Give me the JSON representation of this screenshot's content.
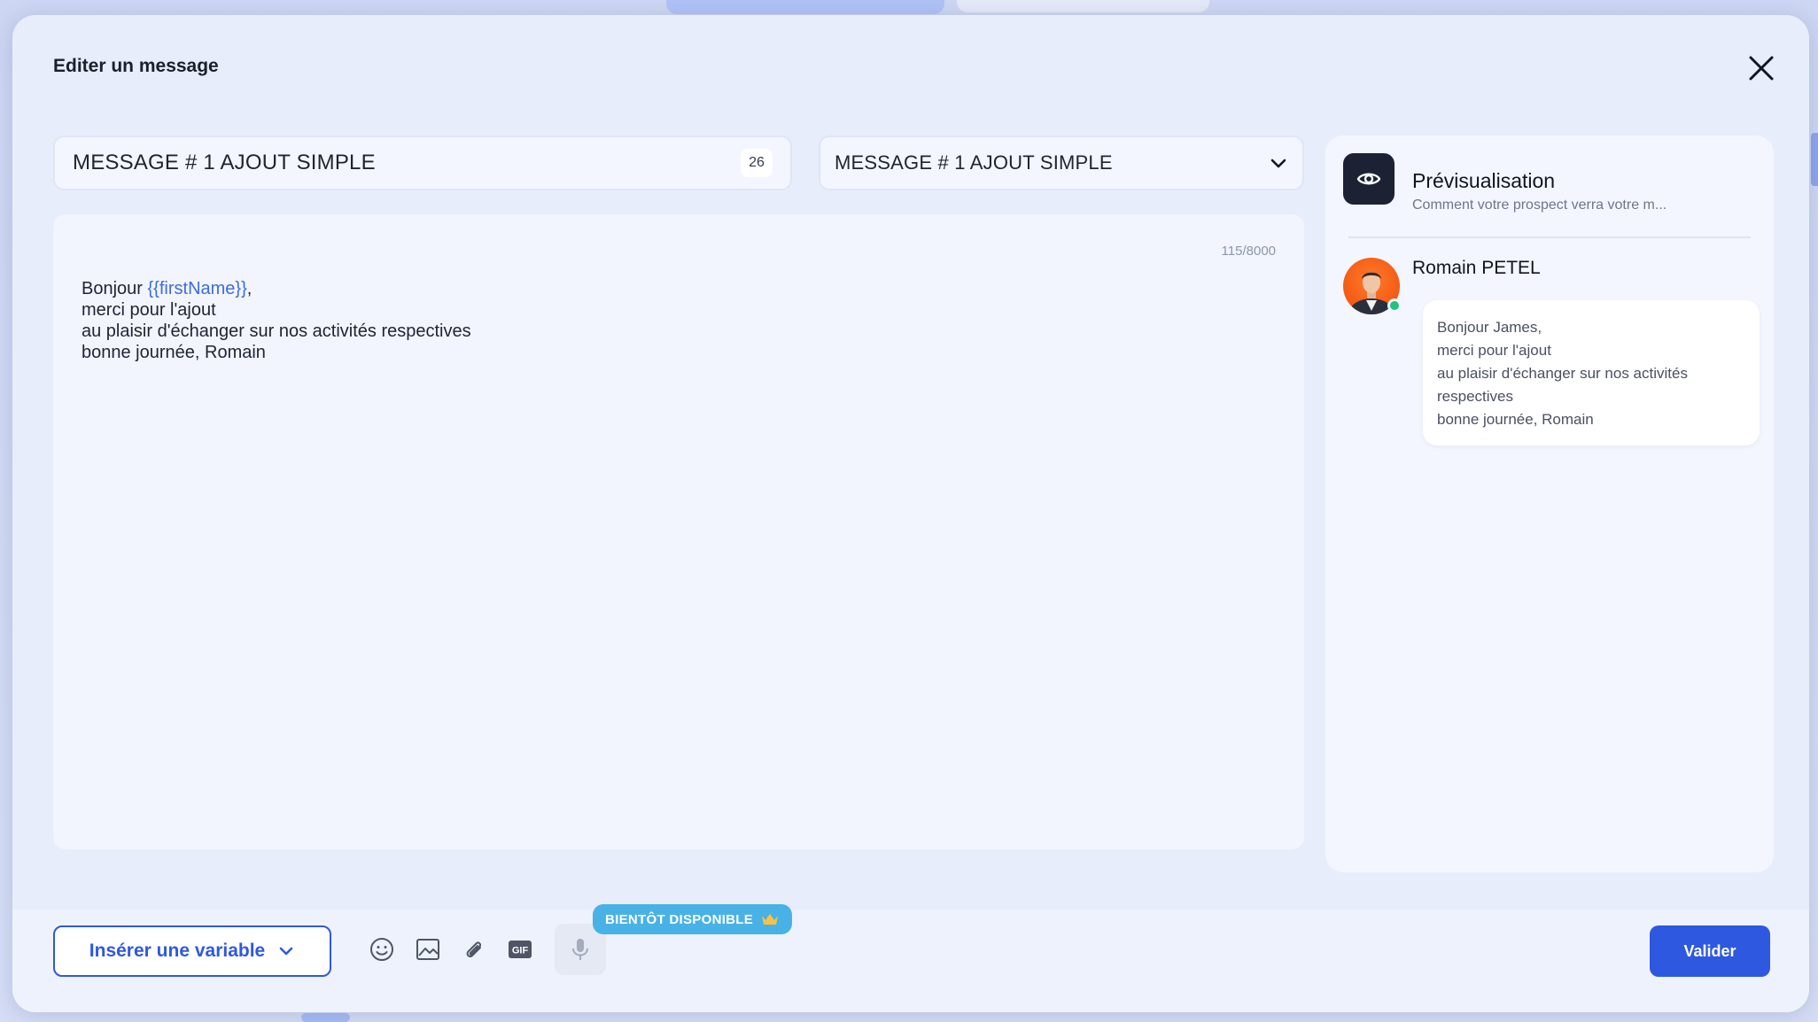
{
  "modal": {
    "title": "Editer un message"
  },
  "name_field": {
    "value": "MESSAGE # 1 AJOUT SIMPLE",
    "char_count": "26"
  },
  "template_select": {
    "selected": "MESSAGE # 1 AJOUT SIMPLE"
  },
  "editor": {
    "counter": "115/8000",
    "line1_prefix": "Bonjour ",
    "line1_variable": "{{firstName}}",
    "line1_suffix": ",",
    "line2": "merci pour l'ajout",
    "line3": "au plaisir d'échanger sur nos activités respectives",
    "line4": "bonne journée, Romain"
  },
  "preview": {
    "title": "Prévisualisation",
    "subtitle": "Comment votre prospect verra votre m...",
    "sender": "Romain PETEL",
    "bubble_lines": [
      "Bonjour James,",
      "merci pour l'ajout",
      "au plaisir d'échanger sur nos activités",
      "respectives",
      "bonne journée, Romain"
    ]
  },
  "footer": {
    "insert_variable_label": "Insérer une variable",
    "soon_badge": "BIENTÔT DISPONIBLE",
    "validate_label": "Valider"
  },
  "colors": {
    "accent": "#2f58e0",
    "variable_text": "#3d6be0",
    "badge": "#48b2e6",
    "online": "#22c27a"
  },
  "icons": {
    "close": "close-icon",
    "eye": "eye-icon",
    "chevron": "chevron-down-icon",
    "emoji": "emoji-icon",
    "image": "image-icon",
    "attach": "paperclip-icon",
    "gif": "gif-icon",
    "mic": "microphone-icon",
    "crown": "crown-icon"
  }
}
